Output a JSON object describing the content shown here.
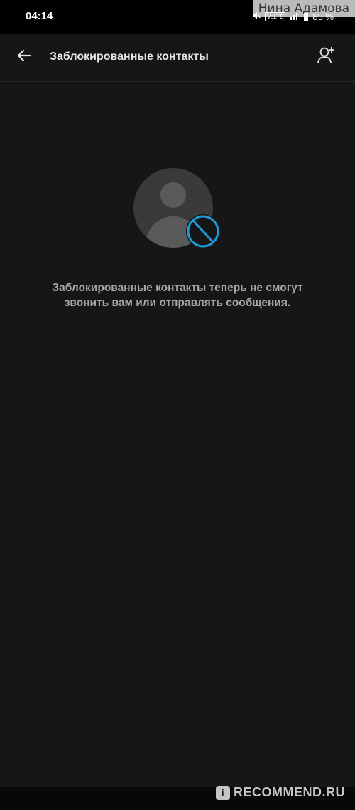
{
  "status_bar": {
    "time": "04:14",
    "volte": "VoLTE",
    "battery_percent": "85 %"
  },
  "watermark_top": "Нина Адамова",
  "app_bar": {
    "title": "Заблокированные контакты",
    "back_icon": "arrow-left-icon",
    "add_icon": "add-contact-icon"
  },
  "empty_state": {
    "illustration_icon": "blocked-person-icon",
    "message_line1": "Заблокированные контакты теперь не смогут",
    "message_line2": "звонить вам или отправлять сообщения."
  },
  "watermark_bottom": {
    "badge": "i",
    "text": "RECOMMEND.RU"
  },
  "colors": {
    "background": "#161616",
    "accent_blue": "#1e9bd7",
    "illustration_circle": "#3a3a3a",
    "illustration_figure": "#5a5a5a",
    "text_secondary": "#a6a6a6"
  }
}
